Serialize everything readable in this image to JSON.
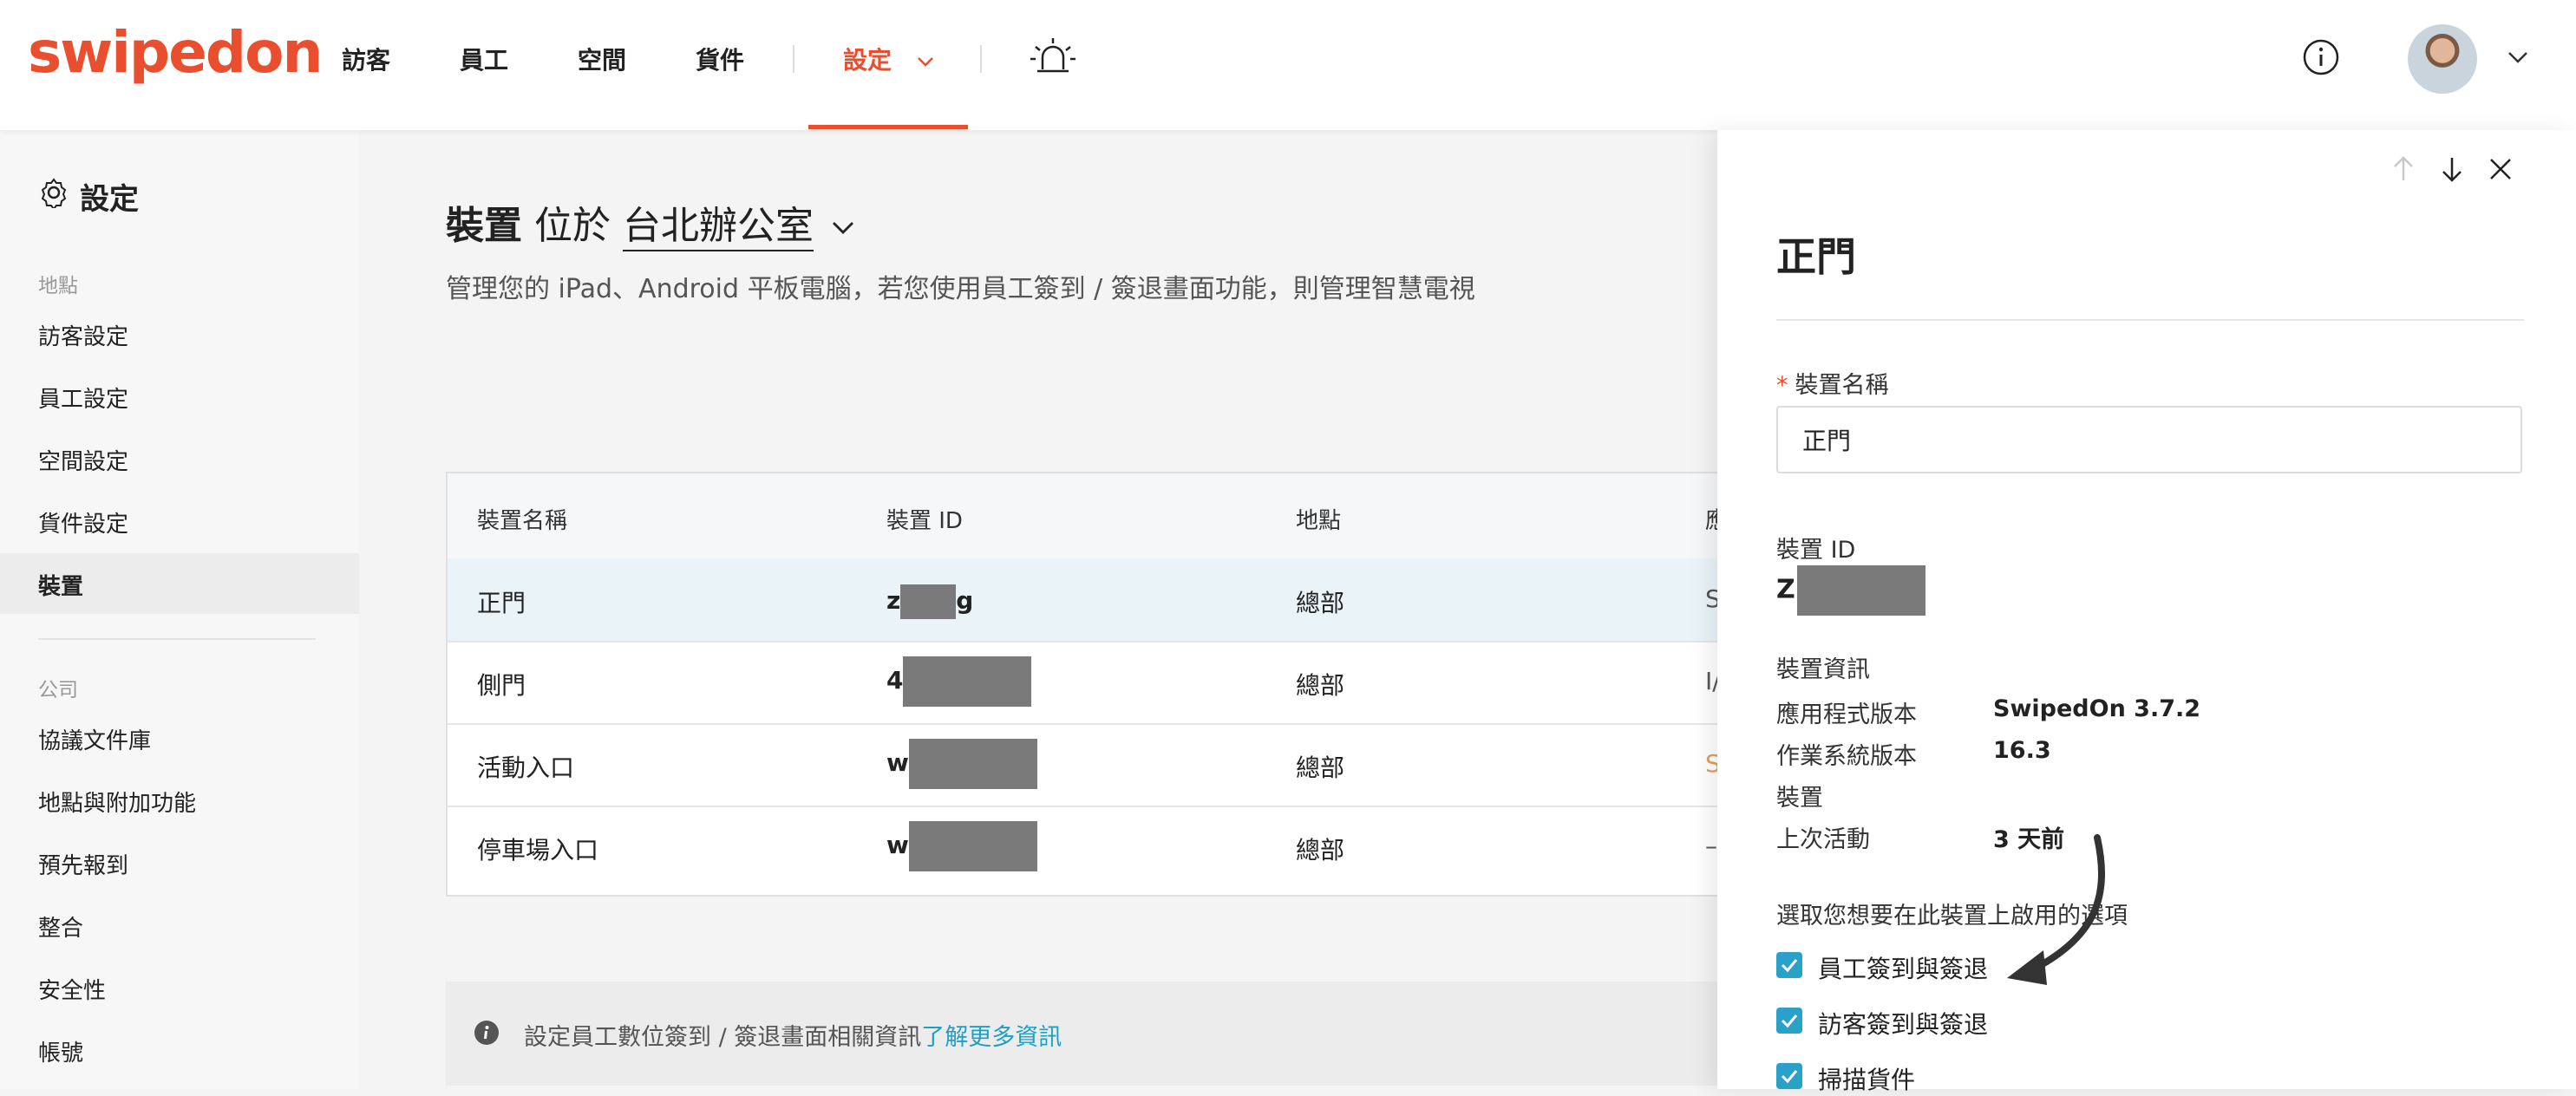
{
  "topnav": {
    "logo": "swipedon",
    "items": [
      "訪客",
      "員工",
      "空間",
      "貨件"
    ],
    "settings_label": "設定"
  },
  "sidebar": {
    "title": "設定",
    "groups": [
      {
        "label": "地點",
        "items": [
          "訪客設定",
          "員工設定",
          "空間設定",
          "貨件設定",
          "裝置"
        ]
      },
      {
        "label": "公司",
        "items": [
          "協議文件庫",
          "地點與附加功能",
          "預先報到",
          "整合",
          "安全性",
          "帳號"
        ]
      }
    ],
    "active_item": "裝置"
  },
  "main": {
    "title_strong": "裝置",
    "title_at": "位於",
    "title_location": "台北辦公室",
    "subtitle": "管理您的 iPad、Android 平板電腦，若您使用員工簽到 / 簽退畫面功能，則管理智慧電視",
    "table": {
      "columns": [
        "裝置名稱",
        "裝置 ID",
        "地點",
        "應"
      ],
      "rows": [
        {
          "name": "正門",
          "id_start": "z",
          "id_end": "g",
          "location": "總部",
          "extra": "S"
        },
        {
          "name": "側門",
          "id_start": "4",
          "id_end": "",
          "location": "總部",
          "extra": "I/"
        },
        {
          "name": "活動入口",
          "id_start": "w",
          "id_end": "",
          "location": "總部",
          "extra": "S"
        },
        {
          "name": "停車場入口",
          "id_start": "w",
          "id_end": "",
          "location": "總部",
          "extra": "–"
        }
      ]
    },
    "info": {
      "text": "設定員工數位簽到 / 簽退畫面相關資訊",
      "link": "了解更多資訊"
    }
  },
  "panel": {
    "title": "正門",
    "name_label": "裝置名稱",
    "name_value": "正門",
    "id_label": "裝置 ID",
    "id_start": "Z",
    "info_label": "裝置資訊",
    "info": [
      {
        "k": "應用程式版本",
        "v": "SwipedOn 3.7.2"
      },
      {
        "k": "作業系統版本",
        "v": "16.3"
      },
      {
        "k": "裝置",
        "v": ""
      },
      {
        "k": "上次活動",
        "v": "3 天前"
      }
    ],
    "options_label": "選取您想要在此裝置上啟用的選項",
    "options": [
      "員工簽到與簽退",
      "訪客簽到與簽退",
      "掃描貨件"
    ]
  },
  "colors": {
    "brand": "#e94f2e",
    "accent": "#2aa2c8",
    "link": "#1e9fc5"
  }
}
